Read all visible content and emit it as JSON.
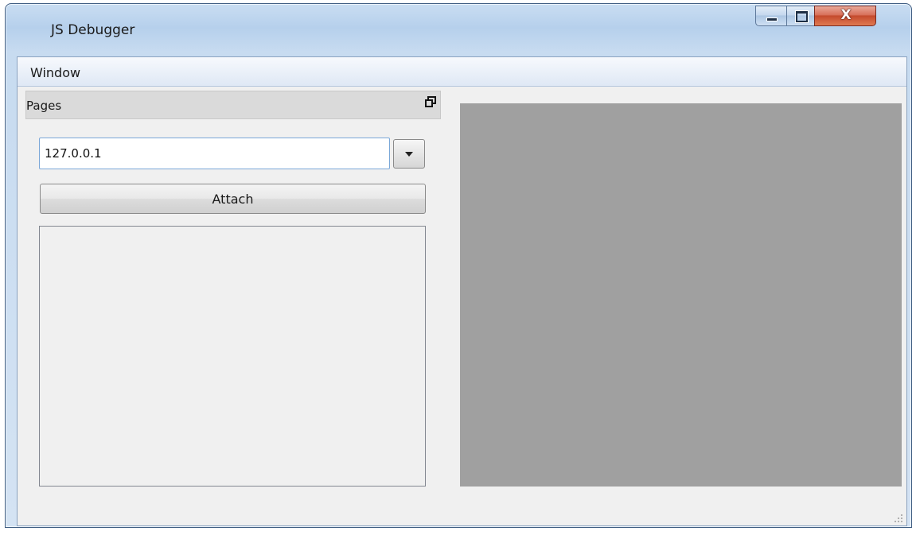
{
  "window": {
    "title": "JS Debugger",
    "controls": {
      "close_glyph": "X"
    }
  },
  "menubar": {
    "items": [
      "Window"
    ]
  },
  "pages_dock": {
    "title": "Pages",
    "float_icon": "float-icon",
    "host_input": {
      "value": "127.0.0.1",
      "placeholder": ""
    },
    "attach_label": "Attach",
    "pages": []
  },
  "colors": {
    "view_background": "#a0a0a0",
    "client_background": "#f0f0f0",
    "close_button": "#c44a2e"
  }
}
